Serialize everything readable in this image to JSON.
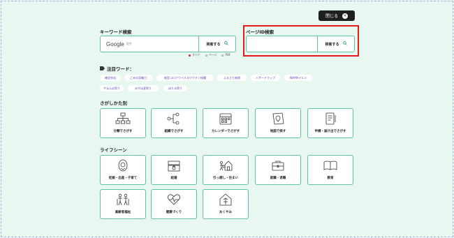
{
  "close_label": "閉じる",
  "keyword": {
    "title": "キーワード検索",
    "google_label": "Google",
    "google_sub": "提供",
    "button_label": "検索する"
  },
  "page_id": {
    "title": "ページID検索",
    "button_label": "検索する"
  },
  "radio_options": [
    "すべて",
    "ページ",
    "PDF"
  ],
  "featured": {
    "title": "注目ワード：",
    "tags": [
      "確定申告",
      "ごみの収集日",
      "新型コロナウイルスワクチン接種",
      "ふるさと納税",
      "ハザードマップ",
      "INAMAイルミ",
      "やまんば祭り",
      "みずほ夏祭り",
      "ほたる祭り"
    ]
  },
  "search_methods": {
    "title": "さがしかた別",
    "items": [
      {
        "label": "分類でさがす",
        "icon": "hierarchy-icon"
      },
      {
        "label": "組織でさがす",
        "icon": "organization-icon"
      },
      {
        "label": "カレンダーでさがす",
        "icon": "calendar-icon"
      },
      {
        "label": "地図で探す",
        "icon": "map-icon"
      },
      {
        "label": "申請・届け出でさがす",
        "icon": "document-icon"
      }
    ]
  },
  "life_scenes": {
    "title": "ライフシーン",
    "items": [
      {
        "label": "妊娠・出産・子育て",
        "icon": "baby-icon"
      },
      {
        "label": "結婚",
        "icon": "ring-box-icon"
      },
      {
        "label": "引っ越し・住まい",
        "icon": "moving-icon"
      },
      {
        "label": "就職・退職",
        "icon": "briefcase-icon"
      },
      {
        "label": "教育",
        "icon": "book-icon"
      },
      {
        "label": "高齢者福祉",
        "icon": "elderly-icon"
      },
      {
        "label": "健康づくり",
        "icon": "health-icon"
      },
      {
        "label": "おくやみ",
        "icon": "house-icon"
      }
    ]
  },
  "colors": {
    "accent": "#5cc3a8",
    "background": "#e8f7f0",
    "highlight": "#e61a1a",
    "tag_text": "#5a48b8"
  }
}
